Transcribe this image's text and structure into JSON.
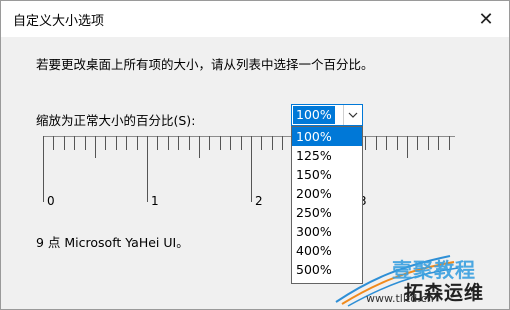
{
  "window": {
    "title": "自定义大小选项",
    "close_glyph": "✕"
  },
  "description": "若要更改桌面上所有项的大小，请从列表中选择一个百分比。",
  "scale": {
    "label": "缩放为正常大小的百分比(S):",
    "selected": "100%",
    "options": [
      "100%",
      "125%",
      "150%",
      "200%",
      "250%",
      "300%",
      "400%",
      "500%"
    ]
  },
  "ruler": {
    "labels": [
      "0",
      "1",
      "2",
      "3"
    ]
  },
  "font_info": "9 点 Microsoft YaHei UI。",
  "watermark": {
    "brand_cn": "壹聚教程",
    "brand_cn2": "拓森运维",
    "url": "www.tlltd.cn"
  },
  "colors": {
    "accent": "#0078d7",
    "watermark_blue": "#3aa0e0"
  }
}
